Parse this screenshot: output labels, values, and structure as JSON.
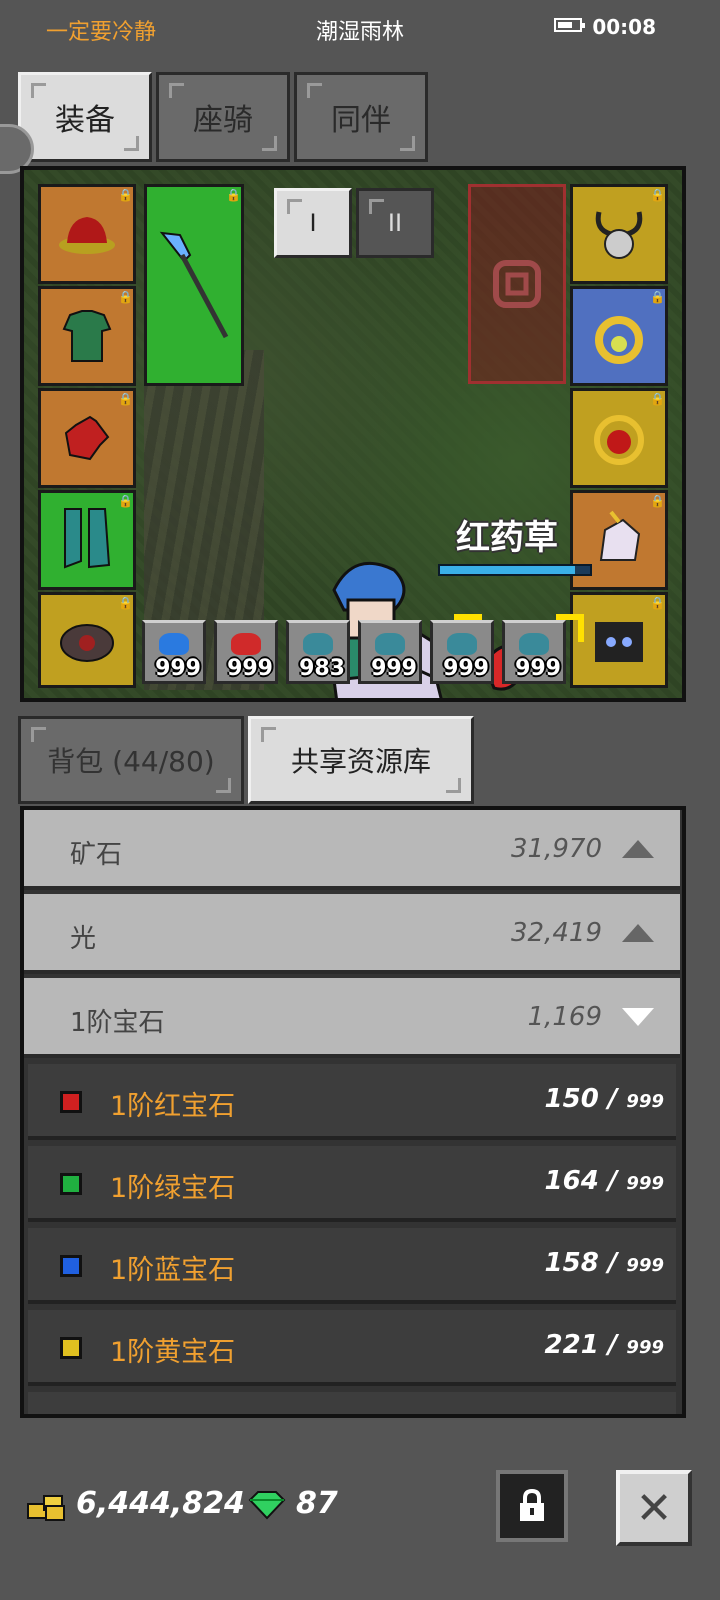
{
  "status": {
    "left_text": "一定要冷静",
    "location": "潮湿雨林",
    "time": "00:08",
    "battery_level": 0.7
  },
  "top_tabs": [
    {
      "label": "装备",
      "active": true
    },
    {
      "label": "座骑",
      "active": false
    },
    {
      "label": "同伴",
      "active": false
    }
  ],
  "scene": {
    "page_buttons": [
      "I",
      "II"
    ],
    "target_name": "红药草",
    "target_hp": 0.9,
    "quick_slots": [
      {
        "count": "999",
        "color": "#2a7ae0"
      },
      {
        "count": "999",
        "color": "#d02a2a"
      },
      {
        "count": "983",
        "color": "#3a8a9a"
      },
      {
        "count": "999",
        "color": "#3a8a9a"
      },
      {
        "count": "999",
        "color": "#3a8a9a"
      },
      {
        "count": "999",
        "color": "#3a8a9a"
      }
    ]
  },
  "bag_tabs": [
    {
      "label": "背包 (44/80)",
      "active": false
    },
    {
      "label": "共享资源库",
      "active": true
    }
  ],
  "resources": [
    {
      "name": "矿石",
      "value": "31,970",
      "expanded": false
    },
    {
      "name": "光",
      "value": "32,419",
      "expanded": false
    },
    {
      "name": "1阶宝石",
      "value": "1,169",
      "expanded": true
    }
  ],
  "gems": [
    {
      "name": "1阶红宝石",
      "count": "150",
      "max": "999",
      "color": "#d02020"
    },
    {
      "name": "1阶绿宝石",
      "count": "164",
      "max": "999",
      "color": "#20b040"
    },
    {
      "name": "1阶蓝宝石",
      "count": "158",
      "max": "999",
      "color": "#2060e0"
    },
    {
      "name": "1阶黄宝石",
      "count": "221",
      "max": "999",
      "color": "#e0c020"
    }
  ],
  "currency": {
    "gold": "6,444,824",
    "gems": "87"
  },
  "colors": {
    "accent": "#f0a030",
    "panel": "#555555"
  }
}
